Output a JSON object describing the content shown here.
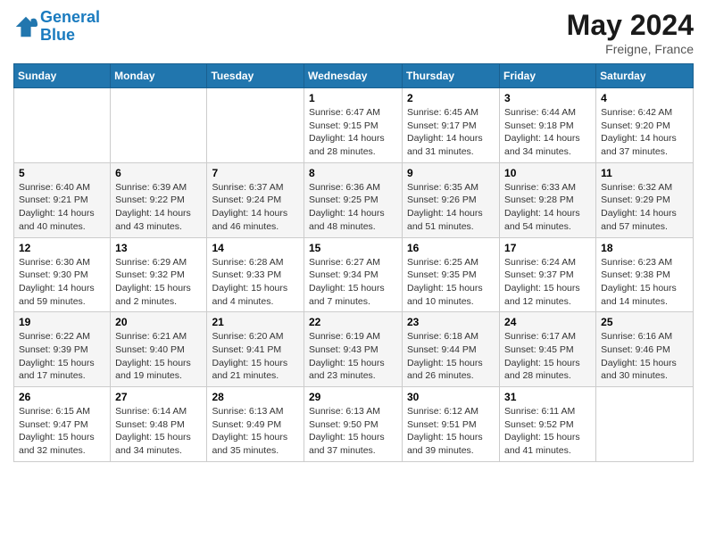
{
  "logo": {
    "line1": "General",
    "line2": "Blue"
  },
  "title": "May 2024",
  "subtitle": "Freigne, France",
  "days_of_week": [
    "Sunday",
    "Monday",
    "Tuesday",
    "Wednesday",
    "Thursday",
    "Friday",
    "Saturday"
  ],
  "weeks": [
    [
      {
        "day": "",
        "info": ""
      },
      {
        "day": "",
        "info": ""
      },
      {
        "day": "",
        "info": ""
      },
      {
        "day": "1",
        "info": "Sunrise: 6:47 AM\nSunset: 9:15 PM\nDaylight: 14 hours and 28 minutes."
      },
      {
        "day": "2",
        "info": "Sunrise: 6:45 AM\nSunset: 9:17 PM\nDaylight: 14 hours and 31 minutes."
      },
      {
        "day": "3",
        "info": "Sunrise: 6:44 AM\nSunset: 9:18 PM\nDaylight: 14 hours and 34 minutes."
      },
      {
        "day": "4",
        "info": "Sunrise: 6:42 AM\nSunset: 9:20 PM\nDaylight: 14 hours and 37 minutes."
      }
    ],
    [
      {
        "day": "5",
        "info": "Sunrise: 6:40 AM\nSunset: 9:21 PM\nDaylight: 14 hours and 40 minutes."
      },
      {
        "day": "6",
        "info": "Sunrise: 6:39 AM\nSunset: 9:22 PM\nDaylight: 14 hours and 43 minutes."
      },
      {
        "day": "7",
        "info": "Sunrise: 6:37 AM\nSunset: 9:24 PM\nDaylight: 14 hours and 46 minutes."
      },
      {
        "day": "8",
        "info": "Sunrise: 6:36 AM\nSunset: 9:25 PM\nDaylight: 14 hours and 48 minutes."
      },
      {
        "day": "9",
        "info": "Sunrise: 6:35 AM\nSunset: 9:26 PM\nDaylight: 14 hours and 51 minutes."
      },
      {
        "day": "10",
        "info": "Sunrise: 6:33 AM\nSunset: 9:28 PM\nDaylight: 14 hours and 54 minutes."
      },
      {
        "day": "11",
        "info": "Sunrise: 6:32 AM\nSunset: 9:29 PM\nDaylight: 14 hours and 57 minutes."
      }
    ],
    [
      {
        "day": "12",
        "info": "Sunrise: 6:30 AM\nSunset: 9:30 PM\nDaylight: 14 hours and 59 minutes."
      },
      {
        "day": "13",
        "info": "Sunrise: 6:29 AM\nSunset: 9:32 PM\nDaylight: 15 hours and 2 minutes."
      },
      {
        "day": "14",
        "info": "Sunrise: 6:28 AM\nSunset: 9:33 PM\nDaylight: 15 hours and 4 minutes."
      },
      {
        "day": "15",
        "info": "Sunrise: 6:27 AM\nSunset: 9:34 PM\nDaylight: 15 hours and 7 minutes."
      },
      {
        "day": "16",
        "info": "Sunrise: 6:25 AM\nSunset: 9:35 PM\nDaylight: 15 hours and 10 minutes."
      },
      {
        "day": "17",
        "info": "Sunrise: 6:24 AM\nSunset: 9:37 PM\nDaylight: 15 hours and 12 minutes."
      },
      {
        "day": "18",
        "info": "Sunrise: 6:23 AM\nSunset: 9:38 PM\nDaylight: 15 hours and 14 minutes."
      }
    ],
    [
      {
        "day": "19",
        "info": "Sunrise: 6:22 AM\nSunset: 9:39 PM\nDaylight: 15 hours and 17 minutes."
      },
      {
        "day": "20",
        "info": "Sunrise: 6:21 AM\nSunset: 9:40 PM\nDaylight: 15 hours and 19 minutes."
      },
      {
        "day": "21",
        "info": "Sunrise: 6:20 AM\nSunset: 9:41 PM\nDaylight: 15 hours and 21 minutes."
      },
      {
        "day": "22",
        "info": "Sunrise: 6:19 AM\nSunset: 9:43 PM\nDaylight: 15 hours and 23 minutes."
      },
      {
        "day": "23",
        "info": "Sunrise: 6:18 AM\nSunset: 9:44 PM\nDaylight: 15 hours and 26 minutes."
      },
      {
        "day": "24",
        "info": "Sunrise: 6:17 AM\nSunset: 9:45 PM\nDaylight: 15 hours and 28 minutes."
      },
      {
        "day": "25",
        "info": "Sunrise: 6:16 AM\nSunset: 9:46 PM\nDaylight: 15 hours and 30 minutes."
      }
    ],
    [
      {
        "day": "26",
        "info": "Sunrise: 6:15 AM\nSunset: 9:47 PM\nDaylight: 15 hours and 32 minutes."
      },
      {
        "day": "27",
        "info": "Sunrise: 6:14 AM\nSunset: 9:48 PM\nDaylight: 15 hours and 34 minutes."
      },
      {
        "day": "28",
        "info": "Sunrise: 6:13 AM\nSunset: 9:49 PM\nDaylight: 15 hours and 35 minutes."
      },
      {
        "day": "29",
        "info": "Sunrise: 6:13 AM\nSunset: 9:50 PM\nDaylight: 15 hours and 37 minutes."
      },
      {
        "day": "30",
        "info": "Sunrise: 6:12 AM\nSunset: 9:51 PM\nDaylight: 15 hours and 39 minutes."
      },
      {
        "day": "31",
        "info": "Sunrise: 6:11 AM\nSunset: 9:52 PM\nDaylight: 15 hours and 41 minutes."
      },
      {
        "day": "",
        "info": ""
      }
    ]
  ]
}
